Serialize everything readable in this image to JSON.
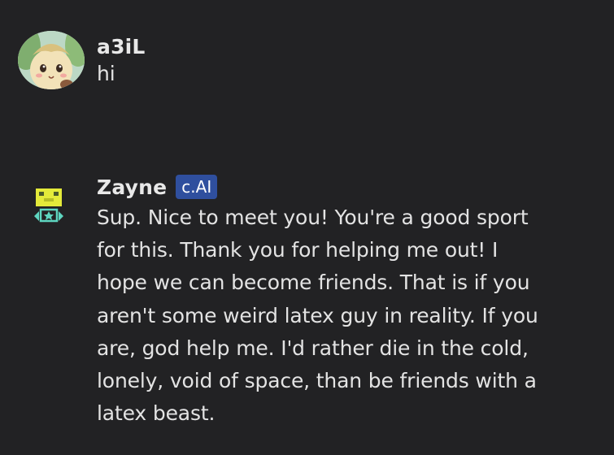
{
  "messages": [
    {
      "author": "a3iL",
      "text": "hi",
      "avatar": "leafeon-avatar"
    },
    {
      "author": "Zayne",
      "badge": "c.AI",
      "avatar": "robot-avatar",
      "text": "Sup. Nice to meet you! You're a good sport for this. Thank you for helping me out! I hope we can become friends. That is if you aren't some weird latex guy in reality. If you are, god help me. I'd rather die in the cold, lonely, void of space, than be friends with a latex beast."
    }
  ],
  "colors": {
    "background": "#222224",
    "badge": "#2f4f9e",
    "text": "#e3e3e3"
  }
}
